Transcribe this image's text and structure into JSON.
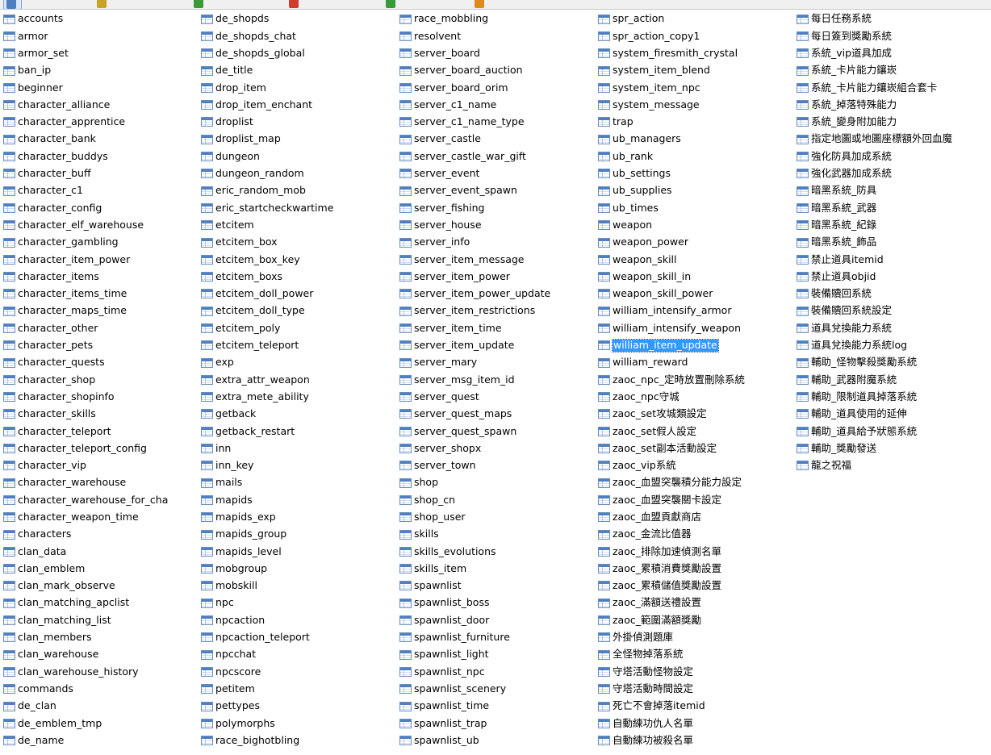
{
  "toolbar": {
    "buttons": [
      {
        "icon": "open-table-icon",
        "label": "",
        "active": true,
        "color": "#4f7fc2"
      },
      {
        "icon": "design-table-icon",
        "label": "",
        "color": "#c9a227"
      },
      {
        "icon": "new-table-icon",
        "label": "",
        "color": "#3a9a3a"
      },
      {
        "icon": "delete-table-icon",
        "label": "",
        "color": "#d23b2b"
      },
      {
        "icon": "import-wizard-icon",
        "label": "",
        "color": "#3a9a3a"
      },
      {
        "icon": "export-wizard-icon",
        "label": "",
        "color": "#e08a1e"
      }
    ]
  },
  "selection_color": "#3399ff",
  "selected_item": "william_item_update",
  "columns": [
    [
      "accounts",
      "armor",
      "armor_set",
      "ban_ip",
      "beginner",
      "character_alliance",
      "character_apprentice",
      "character_bank",
      "character_buddys",
      "character_buff",
      "character_c1",
      "character_config",
      "character_elf_warehouse",
      "character_gambling",
      "character_item_power",
      "character_items",
      "character_items_time",
      "character_maps_time",
      "character_other",
      "character_pets",
      "character_quests",
      "character_shop",
      "character_shopinfo",
      "character_skills",
      "character_teleport",
      "character_teleport_config",
      "character_vip",
      "character_warehouse",
      "character_warehouse_for_cha",
      "character_weapon_time",
      "characters",
      "clan_data",
      "clan_emblem",
      "clan_mark_observe",
      "clan_matching_apclist",
      "clan_matching_list",
      "clan_members",
      "clan_warehouse",
      "clan_warehouse_history",
      "commands",
      "de_clan",
      "de_emblem_tmp",
      "de_name"
    ],
    [
      "de_shopds",
      "de_shopds_chat",
      "de_shopds_global",
      "de_title",
      "drop_item",
      "drop_item_enchant",
      "droplist",
      "droplist_map",
      "dungeon",
      "dungeon_random",
      "eric_random_mob",
      "eric_startcheckwartime",
      "etcitem",
      "etcitem_box",
      "etcitem_box_key",
      "etcitem_boxs",
      "etcitem_doll_power",
      "etcitem_doll_type",
      "etcitem_poly",
      "etcitem_teleport",
      "exp",
      "extra_attr_weapon",
      "extra_mete_ability",
      "getback",
      "getback_restart",
      "inn",
      "inn_key",
      "mails",
      "mapids",
      "mapids_exp",
      "mapids_group",
      "mapids_level",
      "mobgroup",
      "mobskill",
      "npc",
      "npcaction",
      "npcaction_teleport",
      "npcchat",
      "npcscore",
      "petitem",
      "pettypes",
      "polymorphs",
      "race_bighotbling"
    ],
    [
      "race_mobbling",
      "resolvent",
      "server_board",
      "server_board_auction",
      "server_board_orim",
      "server_c1_name",
      "server_c1_name_type",
      "server_castle",
      "server_castle_war_gift",
      "server_event",
      "server_event_spawn",
      "server_fishing",
      "server_house",
      "server_info",
      "server_item_message",
      "server_item_power",
      "server_item_power_update",
      "server_item_restrictions",
      "server_item_time",
      "server_item_update",
      "server_mary",
      "server_msg_item_id",
      "server_quest",
      "server_quest_maps",
      "server_quest_spawn",
      "server_shopx",
      "server_town",
      "shop",
      "shop_cn",
      "shop_user",
      "skills",
      "skills_evolutions",
      "skills_item",
      "spawnlist",
      "spawnlist_boss",
      "spawnlist_door",
      "spawnlist_furniture",
      "spawnlist_light",
      "spawnlist_npc",
      "spawnlist_scenery",
      "spawnlist_time",
      "spawnlist_trap",
      "spawnlist_ub"
    ],
    [
      "spr_action",
      "spr_action_copy1",
      "system_firesmith_crystal",
      "system_item_blend",
      "system_item_npc",
      "system_message",
      "trap",
      "ub_managers",
      "ub_rank",
      "ub_settings",
      "ub_supplies",
      "ub_times",
      "weapon",
      "weapon_power",
      "weapon_skill",
      "weapon_skill_in",
      "weapon_skill_power",
      "william_intensify_armor",
      "william_intensify_weapon",
      "william_item_update",
      "william_reward",
      "zaoc_npc_定時放置刪除系統",
      "zaoc_npc守城",
      "zaoc_set攻城類設定",
      "zaoc_set假人設定",
      "zaoc_set副本活動設定",
      "zaoc_vip系統",
      "zaoc_血盟突襲積分能力設定",
      "zaoc_血盟突襲關卡設定",
      "zaoc_血盟貢獻商店",
      "zaoc_金流比值器",
      "zaoc_排除加速偵測名單",
      "zaoc_累積消費獎勵設置",
      "zaoc_累積儲值獎勵設置",
      "zaoc_滿額送禮設置",
      "zaoc_範圍滿額獎勵",
      "外掛偵測題庫",
      "全怪物掉落系統",
      "守塔活動怪物設定",
      "守塔活動時間設定",
      "死亡不會掉落itemid",
      "自動練功仇人名單",
      "自動練功被殺名單"
    ],
    [
      "每日任務系統",
      "每日簽到獎勵系統",
      "系統_vip道具加成",
      "系統_卡片能力鑲崁",
      "系統_卡片能力鑲崁組合套卡",
      "系統_掉落特殊能力",
      "系統_變身附加能力",
      "指定地圖或地圖座標額外回血魔",
      "強化防具加成系統",
      "強化武器加成系統",
      "暗黑系統_防具",
      "暗黑系統_武器",
      "暗黑系統_紀錄",
      "暗黑系統_飾品",
      "禁止道具itemid",
      "禁止道具objid",
      "裝備贖回系統",
      "裝備贖回系統設定",
      "道具兌換能力系統",
      "道具兌換能力系統log",
      "輔助_怪物擊殺獎勵系統",
      "輔助_武器附魔系統",
      "輔助_限制道具掉落系統",
      "輔助_道具使用的延伸",
      "輔助_道具給予狀態系統",
      "輔助_獎勵發送",
      "龍之祝福"
    ]
  ]
}
